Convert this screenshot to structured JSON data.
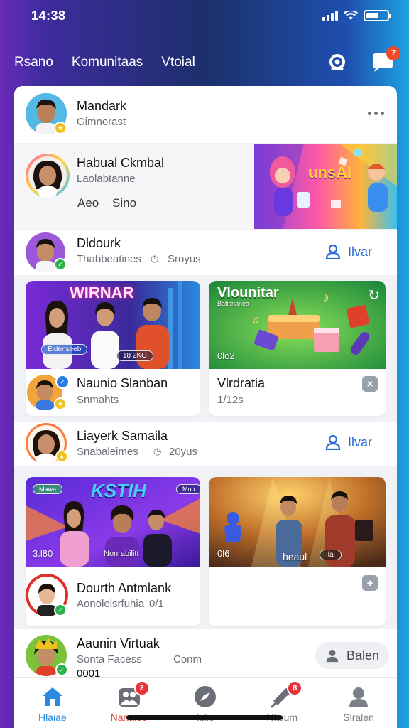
{
  "status": {
    "time": "14:38"
  },
  "top_nav": {
    "tabs": [
      "Rsano",
      "Komunitaas",
      "Vtoial"
    ],
    "notification_count": "7"
  },
  "feed": {
    "rows": [
      {
        "name": "Mandark",
        "subtitle": "Gimnorast"
      },
      {
        "name": "Habual Ckmbal",
        "subtitle": "Laolabtanne",
        "actions": [
          "Aeo",
          "Sino"
        ],
        "banner_text": "unsAI"
      },
      {
        "name": "Dldourk",
        "subtitle": "Thabbeatines",
        "meta": "Sroyus",
        "follow_label": "Ilvar"
      },
      {
        "name": "Liayerk Samaila",
        "subtitle": "Snabaleimes",
        "meta": "20yus",
        "follow_label": "Ilvar"
      },
      {
        "name": "Aaunin Virtuak",
        "subtitle": "Sonta Facess",
        "meta": "Conm",
        "extra": "0001",
        "join_label": "Balen"
      }
    ],
    "cards": [
      {
        "title_overlay": "WIRNAR",
        "tag_left": "Eldenseeb",
        "tag_right": "18 2KO",
        "author": "Naunio Slanban",
        "meta": "Snmahts"
      },
      {
        "title_overlay": "Vlounitar",
        "caption": "Batisnanea",
        "count": "0lo2",
        "author": "Vlrdratia",
        "meta": "1/12s",
        "action": "×"
      },
      {
        "title_overlay": "KSTIH",
        "tag_left": "Mawa",
        "tag_right": "Muo",
        "count": "3.l80",
        "tag_bottom": "Nonrabilitt",
        "author": "Dourth Antmlank",
        "meta": "Aonolelsrfuhia",
        "meta_count": "0/1"
      },
      {
        "count": "0l6",
        "tag_bottom": "heaul",
        "tag_pill": "Ilal",
        "action": "+"
      }
    ]
  },
  "bottom_nav": {
    "items": [
      {
        "label": "Hlaiae",
        "icon": "home-icon",
        "active": true
      },
      {
        "label": "Nanaieo",
        "icon": "people-icon",
        "badge": "2"
      },
      {
        "label": "Islio",
        "icon": "compass-icon"
      },
      {
        "label": "Nlaium",
        "icon": "megaphone-icon",
        "badge": "8"
      },
      {
        "label": "Slralen",
        "icon": "profile-icon"
      }
    ]
  },
  "colors": {
    "accent": "#2a6bd8",
    "badge": "#e8333a",
    "bg_left": "#6a2bb8",
    "bg_right": "#1da2e0"
  }
}
